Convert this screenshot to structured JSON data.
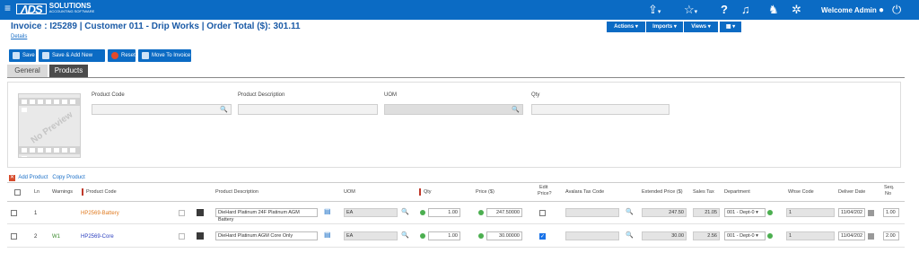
{
  "topbar": {
    "menu_icon": "≡",
    "logo_mark": "ΛDS",
    "logo_name": "SOLUTIONS",
    "logo_tagline": "ACCOUNTING SOFTWARE",
    "welcome": "Welcome Admin",
    "icons": [
      "share-icon",
      "star-icon",
      "help-icon",
      "bell-icon",
      "users-icon",
      "gear-icon",
      "user-icon",
      "power-icon"
    ]
  },
  "header": {
    "title": "Invoice : I25289 | Customer 011 - Drip Works | Order Total ($): 301.11",
    "details_link": "Details",
    "buttons": {
      "actions": "Actions ▾",
      "imports": "Imports ▾",
      "views": "Views ▾",
      "grid": "▦ ▾"
    }
  },
  "actions": {
    "save": "Save",
    "save_add_new": "Save & Add New",
    "reset": "Reset",
    "move_to_invoice": "Move To Invoice"
  },
  "tabs": {
    "general": "General",
    "products": "Products"
  },
  "product_panel": {
    "preview_text": "No Preview",
    "labels": {
      "product_code": "Product Code",
      "product_description": "Product Description",
      "uom": "UOM",
      "qty": "Qty"
    }
  },
  "links": {
    "add_product": "Add Product",
    "copy_product": "Copy Product"
  },
  "grid": {
    "columns": {
      "ln": "Ln",
      "warnings": "Warnings",
      "product_code": "Product Code",
      "product_description": "Product Description",
      "uom": "UOM",
      "qty": "Qty",
      "price": "Price ($)",
      "edit_price_1": "Edit",
      "edit_price_2": "Price?",
      "avalara": "Avalara Tax Code",
      "extended_price": "Extended Price ($)",
      "sales_tax": "Sales Tax",
      "department": "Department",
      "whse_code": "Whse Code",
      "deliver_date": "Deliver Date",
      "seq_1": "Seq.",
      "seq_2": "No"
    },
    "rows": [
      {
        "ln": "1",
        "warning": "",
        "product_code": "HP2569-Battery",
        "product_code_color": "#e07a1f",
        "description": "DieHard Platinum 24F Platinum AGM Battery",
        "uom": "EA",
        "qty": "1.00",
        "price": "247.50000",
        "edit_price": false,
        "extended_price": "247.50",
        "sales_tax": "21.05",
        "department": "001 - Dept-0 ▾",
        "whse_code": "1",
        "deliver_date": "11/04/202",
        "seq": "1.00"
      },
      {
        "ln": "2",
        "warning": "W1",
        "product_code": "HP2569-Core",
        "product_code_color": "#2b3fbf",
        "description": "DieHard Platinum AGM Core Only",
        "uom": "EA",
        "qty": "1.00",
        "price": "30.00000",
        "edit_price": true,
        "extended_price": "30.00",
        "sales_tax": "2.56",
        "department": "001 - Dept-0 ▾",
        "whse_code": "1",
        "deliver_date": "11/04/202",
        "seq": "2.00"
      }
    ]
  }
}
